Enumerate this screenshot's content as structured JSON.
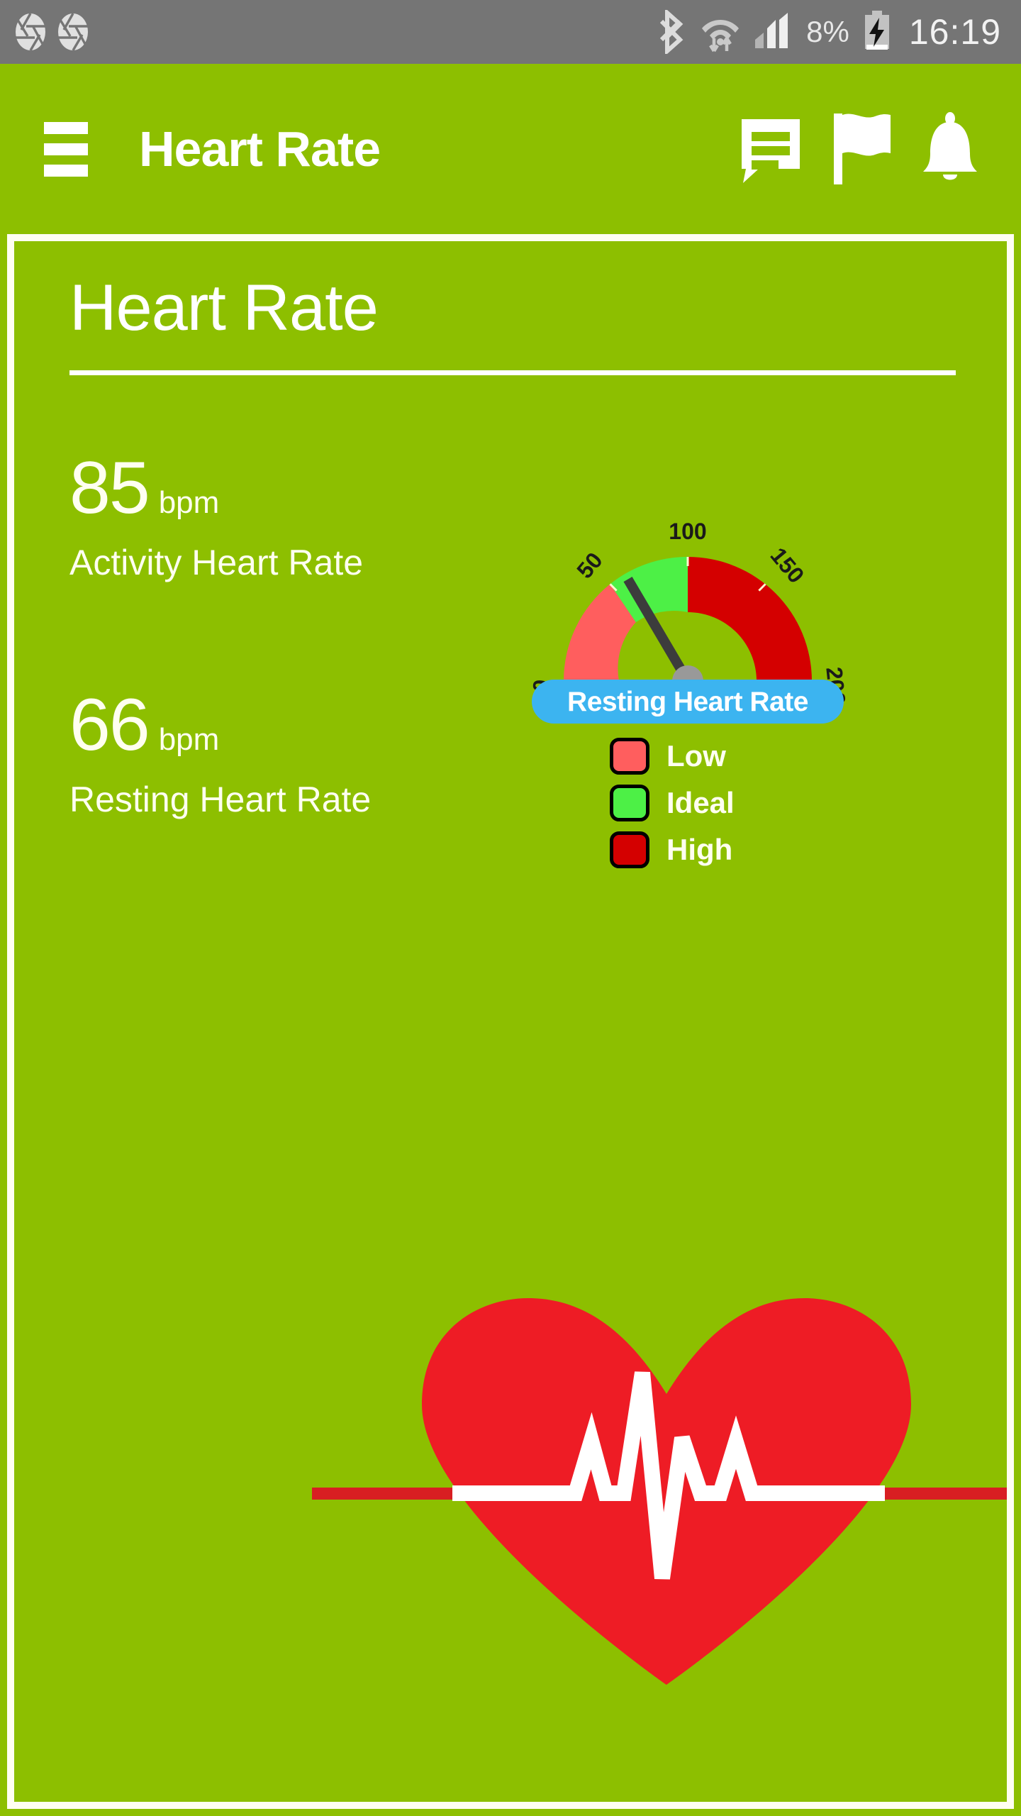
{
  "status_bar": {
    "icons_left": [
      "aperture-icon",
      "aperture-icon"
    ],
    "icons_right": [
      "bluetooth-icon",
      "wifi-icon",
      "signal-icon",
      "battery-charging-icon"
    ],
    "battery_percent": "8%",
    "clock": "16:19",
    "background": "#757575"
  },
  "app_bar": {
    "menu_icon": "hamburger-menu-icon",
    "title": "Heart Rate",
    "actions": [
      {
        "icon": "chat-bubble-icon",
        "name": "messages-button"
      },
      {
        "icon": "flag-icon",
        "name": "flag-button"
      },
      {
        "icon": "bell-icon",
        "name": "notifications-button"
      }
    ],
    "background": "#8DBF00"
  },
  "page": {
    "title": "Heart Rate",
    "background": "#8DBF00",
    "card_border": "#FFFEF2"
  },
  "metrics": [
    {
      "value": "85",
      "unit": "bpm",
      "label": "Activity Heart Rate"
    },
    {
      "value": "66",
      "unit": "bpm",
      "label": "Resting Heart Rate"
    }
  ],
  "gauge": {
    "pill_label": "Resting Heart Rate",
    "pill_color": "#3CB4F0",
    "needle_color": "#3C3C3C",
    "hub_color": "#999999",
    "legend": [
      {
        "label": "Low",
        "color": "#FF5E5E"
      },
      {
        "label": "Ideal",
        "color": "#4DF046"
      },
      {
        "label": "High",
        "color": "#D40000"
      }
    ]
  },
  "chart_data": {
    "type": "gauge",
    "title": "Resting Heart Rate",
    "value": 66,
    "unit": "bpm",
    "min": 0,
    "max": 200,
    "tick_labels": [
      "0",
      "50",
      "100",
      "150",
      "200"
    ],
    "tick_values": [
      0,
      50,
      100,
      150,
      200
    ],
    "bands": [
      {
        "name": "Low",
        "from": 0,
        "to": 57,
        "color": "#FF5E5E"
      },
      {
        "name": "Ideal",
        "from": 57,
        "to": 100,
        "color": "#4DF046"
      },
      {
        "name": "High",
        "from": 100,
        "to": 200,
        "color": "#D40000"
      }
    ],
    "legend": [
      "Low",
      "Ideal",
      "High"
    ],
    "legend_position": "right",
    "needle_value": 66,
    "start_angle_deg": 180,
    "end_angle_deg": 0
  },
  "heart_illustration": {
    "name": "heart-with-pulse-icon",
    "heart_color": "#EE1C25",
    "pulse_color": "#FFFFFF",
    "baseline_color": "#D81E22"
  }
}
